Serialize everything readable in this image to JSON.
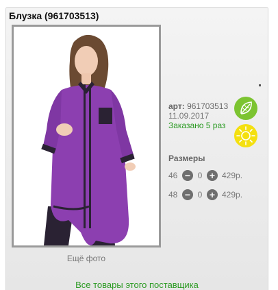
{
  "product": {
    "title": "Блузка (961703513)",
    "more_photo_label": "Ещё фото",
    "art_label": "арт:",
    "art_value": "961703513",
    "date": "11.09.2017",
    "ordered": "Заказано 5 раз"
  },
  "icons": {
    "eco": "leaf-icon",
    "sun": "sun-icon",
    "eco_color": "#7cc431",
    "sun_color": "#f4e010"
  },
  "sizes": {
    "title": "Размеры",
    "rows": [
      {
        "size": "46",
        "minus": "−",
        "qty": "0",
        "plus": "+",
        "price": "429р."
      },
      {
        "size": "48",
        "minus": "−",
        "qty": "0",
        "plus": "+",
        "price": "429р."
      }
    ]
  },
  "footer": {
    "all_goods_label": "Все товары этого поставщика"
  },
  "colors": {
    "accent_green": "#2a9a22",
    "garment_purple": "#8c3fb0"
  }
}
